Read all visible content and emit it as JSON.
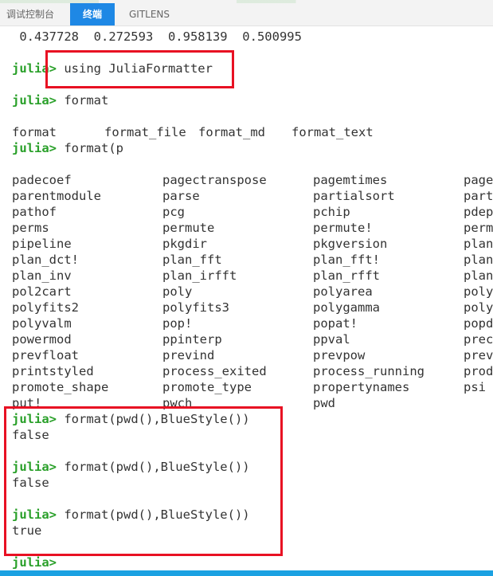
{
  "tabs": [
    {
      "label": "调试控制台"
    },
    {
      "label": "终端"
    },
    {
      "label": "GITLENS"
    }
  ],
  "terminal": {
    "first_line": " 0.437728  0.272593  0.958139  0.500995",
    "prompt": "julia>",
    "cmd_using": " using JuliaFormatter",
    "cmd_format": " format",
    "completions_1": [
      "format",
      "format_file",
      "format_md",
      "format_text"
    ],
    "cmd_format_p": " format(p",
    "completions_2": [
      [
        "padecoef",
        "pagectranspose",
        "pagemtimes",
        "pagetr"
      ],
      [
        "parentmodule",
        "parse",
        "partialsort",
        "partia"
      ],
      [
        "pathof",
        "pcg",
        "pchip",
        "pdepe"
      ],
      [
        "perms",
        "permute",
        "permute!",
        "permu"
      ],
      [
        "pipeline",
        "pkgdir",
        "pkgversion",
        "plan_"
      ],
      [
        "plan_dct!",
        "plan_fft",
        "plan_fft!",
        "plan_"
      ],
      [
        "plan_inv",
        "plan_irfft",
        "plan_rfft",
        "plane"
      ],
      [
        "pol2cart",
        "poly",
        "polyarea",
        "polyf"
      ],
      [
        "polyfits2",
        "polyfits3",
        "polygamma",
        "polyg"
      ],
      [
        "polyvalm",
        "pop!",
        "popat!",
        "popda"
      ],
      [
        "powermod",
        "ppinterp",
        "ppval",
        "preci"
      ],
      [
        "prevfloat",
        "prevind",
        "prevpow",
        "prevp"
      ],
      [
        "printstyled",
        "process_exited",
        "process_running",
        "prod"
      ],
      [
        "promote_shape",
        "promote_type",
        "propertynames",
        "psi"
      ],
      [
        "put!",
        "pwch",
        "pwd",
        ""
      ]
    ],
    "cmd_bluestyle": " format(pwd(),BlueStyle())",
    "result_1": "false",
    "result_2": "false",
    "result_3": "true"
  }
}
